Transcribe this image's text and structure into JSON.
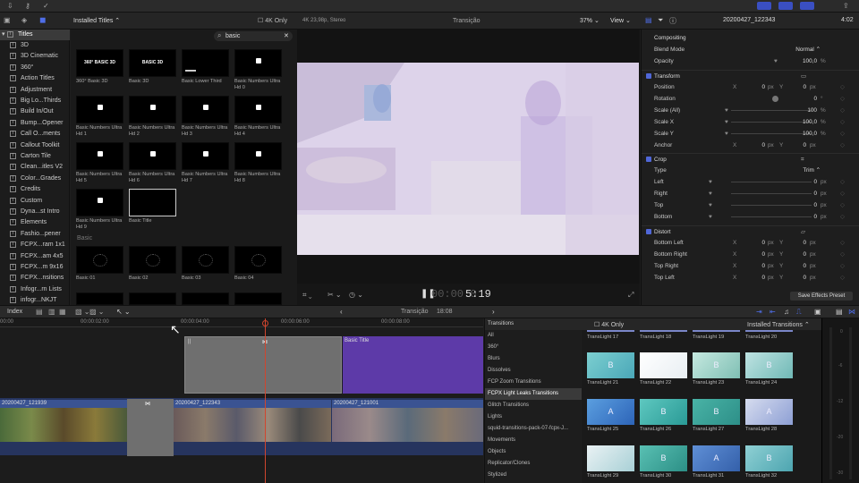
{
  "topbar": {
    "timecode": "4:02",
    "clip_name": "20200427_122343"
  },
  "browser_header": {
    "category": "Installed Titles",
    "filter": "4K Only",
    "search_value": "basic"
  },
  "viewer_header": {
    "format": "4K 23,98p, Stereo",
    "title": "Transição",
    "zoom": "37%",
    "view": "View"
  },
  "viewer_footer": {
    "timecode": "5:19",
    "timecode_dim": "00:00:0"
  },
  "sidebar": {
    "root": "Titles",
    "items": [
      "3D",
      "3D Cinematic",
      "360°",
      "Action Titles",
      "Adjustment",
      "Big Lo...Thirds",
      "Build In/Out",
      "Bump...Opener",
      "Call O...ments",
      "Callout Toolkit",
      "Carton Tile",
      "Clean...itles V2",
      "Color...Grades",
      "Credits",
      "Custom",
      "Dyna...st Intro",
      "Elements",
      "Fashio...pener",
      "FCPX...ram 1x1",
      "FCPX...am 4x5",
      "FCPX...m 9x16",
      "FCPX...nsitions",
      "Infogr...rn Lists",
      "infogr...NKJT"
    ]
  },
  "titles_grid": [
    {
      "label": "360° Basic 3D",
      "thumb_text": "360° BASIC 3D"
    },
    {
      "label": "Basic 3D",
      "thumb_text": "BASIC 3D"
    },
    {
      "label": "Basic Lower Third",
      "thumb_text": ""
    },
    {
      "label": "Basic Numbers Ultra Hd 0",
      "thumb_text": ""
    },
    {
      "label": "Basic Numbers Ultra Hd 1",
      "thumb_text": ""
    },
    {
      "label": "Basic Numbers Ultra Hd 2",
      "thumb_text": ""
    },
    {
      "label": "Basic Numbers Ultra Hd 3",
      "thumb_text": ""
    },
    {
      "label": "Basic Numbers Ultra Hd 4",
      "thumb_text": ""
    },
    {
      "label": "Basic Numbers Ultra Hd 5",
      "thumb_text": ""
    },
    {
      "label": "Basic Numbers Ultra Hd 6",
      "thumb_text": ""
    },
    {
      "label": "Basic Numbers Ultra Hd 7",
      "thumb_text": ""
    },
    {
      "label": "Basic Numbers Ultra Hd 8",
      "thumb_text": ""
    },
    {
      "label": "Basic Numbers Ultra Hd 9",
      "thumb_text": ""
    },
    {
      "label": "Basic Title",
      "thumb_text": ""
    }
  ],
  "basic_section": {
    "heading": "Basic",
    "items": [
      "Basic 01",
      "Basic 02",
      "Basic 03",
      "Basic 04"
    ]
  },
  "inspector": {
    "compositing": "Compositing",
    "blend_mode_label": "Blend Mode",
    "blend_mode": "Normal",
    "opacity_label": "Opacity",
    "opacity": "100,0",
    "pct": "%",
    "transform": "Transform",
    "position": "Position",
    "pos_x": "0",
    "pos_y": "0",
    "rotation": "Rotation",
    "rotation_val": "0",
    "scale_all": "Scale (All)",
    "scale_all_val": "100",
    "scale_x": "Scale X",
    "scale_x_val": "100,0",
    "scale_y": "Scale Y",
    "scale_y_val": "100,0",
    "anchor": "Anchor",
    "anchor_x": "0",
    "anchor_y": "0",
    "crop": "Crop",
    "type_label": "Type",
    "type_val": "Trim",
    "left": "Left",
    "right": "Right",
    "top": "Top",
    "bottom": "Bottom",
    "crop_val": "0",
    "distort": "Distort",
    "bottom_left": "Bottom Left",
    "bottom_right": "Bottom Right",
    "top_right": "Top Right",
    "top_left": "Top Left",
    "px": "px",
    "x": "X",
    "y": "Y",
    "deg": "°",
    "save_preset": "Save Effects Preset"
  },
  "timeline_bar": {
    "index": "Index",
    "project": "Transição",
    "duration": "18:08"
  },
  "ruler": {
    "t0": "00:00",
    "t1": "00:00:02:00",
    "t2": "00:00:04:00",
    "t3": "00:00:06:00",
    "t4": "00:00:08:00"
  },
  "clips": {
    "title_clip": "Basic Title",
    "clip1": "20200427_121939",
    "clip2": "20200427_122343",
    "clip3": "20200427_121001"
  },
  "transitions": {
    "header": "Transitions",
    "filter": "4K Only",
    "category": "Installed Transitions",
    "list": [
      "All",
      "360°",
      "Blurs",
      "Dissolves",
      "FCP Zoom Transitions",
      "FCPX Light Leaks Transitions",
      "Glitch Transitions",
      "Lights",
      "squid-transitions-pack-07-fcpx-J...",
      "Movements",
      "Objects",
      "Replicator/Clones",
      "Stylized"
    ],
    "top_row": [
      "TransLight 17",
      "TransLight 18",
      "TransLight 19",
      "TransLight 20"
    ],
    "grid": [
      {
        "label": "TransLight 21",
        "glyph": "B"
      },
      {
        "label": "TransLight 22",
        "glyph": ""
      },
      {
        "label": "TransLight 23",
        "glyph": "B"
      },
      {
        "label": "TransLight 24",
        "glyph": "B"
      },
      {
        "label": "TransLight 25",
        "glyph": "A"
      },
      {
        "label": "TransLight 26",
        "glyph": "B"
      },
      {
        "label": "TransLight 27",
        "glyph": "B"
      },
      {
        "label": "TransLight 28",
        "glyph": "A"
      },
      {
        "label": "TransLight 29",
        "glyph": ""
      },
      {
        "label": "TransLight 30",
        "glyph": "B"
      },
      {
        "label": "TransLight 31",
        "glyph": "A"
      },
      {
        "label": "TransLight 32",
        "glyph": "B"
      }
    ]
  },
  "meters": {
    "m0": "0",
    "m6": "-6",
    "m12": "-12",
    "m20": "-20",
    "m30": "-30"
  },
  "colors": {
    "accent": "#5067d8",
    "playhead": "#d0452e",
    "title_clip": "#5d3aa8",
    "selected_gray": "#6f6f6f"
  }
}
